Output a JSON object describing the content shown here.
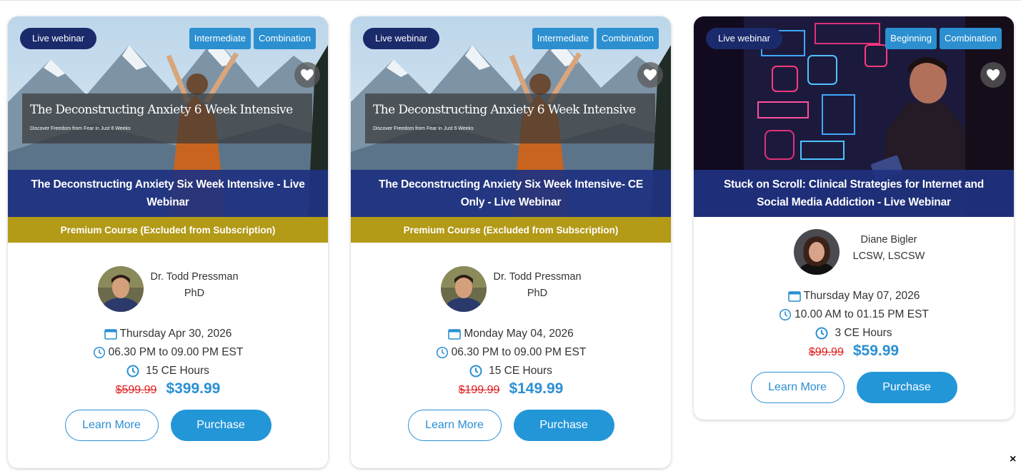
{
  "cards": [
    {
      "badge": "Live webinar",
      "tags": [
        "Intermediate",
        "Combination"
      ],
      "banner_title": "The Deconstructing Anxiety 6 Week Intensive",
      "banner_subtitle": "Discover Freedom from Fear in Just 6 Weeks",
      "title": "The Deconstructing Anxiety Six Week Intensive - Live Webinar",
      "premium_label": "Premium Course (Excluded from Subscription)",
      "instructor_name": "Dr. Todd Pressman",
      "instructor_credentials": "PhD",
      "date": "Thursday Apr 30, 2026",
      "time": "06.30 PM to 09.00 PM EST",
      "ce_hours": "15 CE Hours",
      "old_price": "$599.99",
      "new_price": "$399.99",
      "learn_more": "Learn More",
      "purchase": "Purchase",
      "icons": {
        "favorite": "heart-icon",
        "date": "calendar-icon",
        "time": "clock-icon",
        "hours": "clock-icon"
      }
    },
    {
      "badge": "Live webinar",
      "tags": [
        "Intermediate",
        "Combination"
      ],
      "banner_title": "The Deconstructing Anxiety 6 Week Intensive",
      "banner_subtitle": "Discover Freedom from Fear in Just 6 Weeks",
      "title": "The Deconstructing Anxiety Six Week Intensive- CE Only - Live Webinar",
      "premium_label": "Premium Course (Excluded from Subscription)",
      "instructor_name": "Dr. Todd Pressman",
      "instructor_credentials": "PhD",
      "date": "Monday May 04, 2026",
      "time": "06.30 PM to 09.00 PM EST",
      "ce_hours": "15 CE Hours",
      "old_price": "$199.99",
      "new_price": "$149.99",
      "learn_more": "Learn More",
      "purchase": "Purchase",
      "icons": {
        "favorite": "heart-icon",
        "date": "calendar-icon",
        "time": "clock-icon",
        "hours": "clock-icon"
      }
    },
    {
      "badge": "Live webinar",
      "tags": [
        "Beginning",
        "Combination"
      ],
      "title": "Stuck on Scroll: Clinical Strategies for Internet and Social Media Addiction - Live Webinar",
      "instructor_name": "Diane Bigler",
      "instructor_credentials": "LCSW, LSCSW",
      "date": "Thursday May 07, 2026",
      "time": "10.00 AM to 01.15 PM EST",
      "ce_hours": "3 CE Hours",
      "old_price": "$99.99",
      "new_price": "$59.99",
      "learn_more": "Learn More",
      "purchase": "Purchase",
      "icons": {
        "favorite": "heart-icon",
        "date": "calendar-icon",
        "time": "clock-icon",
        "hours": "clock-icon"
      }
    }
  ],
  "close_glyph": "×",
  "colors": {
    "navy_badge": "#1b2a6b",
    "tag_blue": "#2b8fd0",
    "title_band": "#1f3180",
    "premium_gold": "#b39a17",
    "old_price_red": "#e01e1e",
    "accent_blue": "#2396d8"
  }
}
